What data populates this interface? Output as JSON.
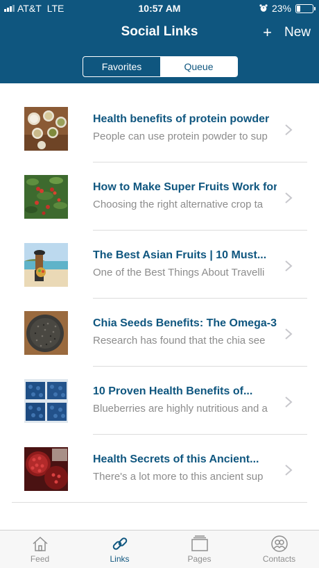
{
  "status_bar": {
    "carrier": "AT&T",
    "network": "LTE",
    "time": "10:57 AM",
    "battery_percent": "23%",
    "battery_level": 0.23,
    "alarm_icon": "alarm-clock-icon"
  },
  "nav": {
    "title": "Social Links",
    "add_icon": "plus-icon",
    "new_label": "New"
  },
  "segments": {
    "favorites": "Favorites",
    "queue": "Queue",
    "selected": "Queue"
  },
  "links": [
    {
      "title": "Health benefits of protein powder",
      "snippet": "People can use protein powder to sup",
      "thumb": "protein"
    },
    {
      "title": "How to Make Super Fruits Work for",
      "snippet": "Choosing the right alternative crop ta",
      "thumb": "berries"
    },
    {
      "title": "The Best Asian Fruits | 10 Must...",
      "snippet": "One of the Best Things About Travelli",
      "thumb": "beach"
    },
    {
      "title": "Chia Seeds Benefits: The Omega-3",
      "snippet": "Research has found that the chia see",
      "thumb": "chia"
    },
    {
      "title": "10 Proven Health Benefits of...",
      "snippet": "Blueberries are highly nutritious and a",
      "thumb": "blueberries"
    },
    {
      "title": "Health Secrets of this Ancient...",
      "snippet": "There's a lot more to this ancient sup",
      "thumb": "pomegranate"
    }
  ],
  "tabs": [
    {
      "label": "Feed",
      "icon": "house-icon"
    },
    {
      "label": "Links",
      "icon": "link-icon"
    },
    {
      "label": "Pages",
      "icon": "pages-icon"
    },
    {
      "label": "Contacts",
      "icon": "contacts-icon"
    }
  ],
  "active_tab": "Links",
  "colors": {
    "header": "#0f567f",
    "accent": "#0f567f",
    "snippet": "#8c8c8c",
    "tab_inactive": "#8e8e8e"
  }
}
